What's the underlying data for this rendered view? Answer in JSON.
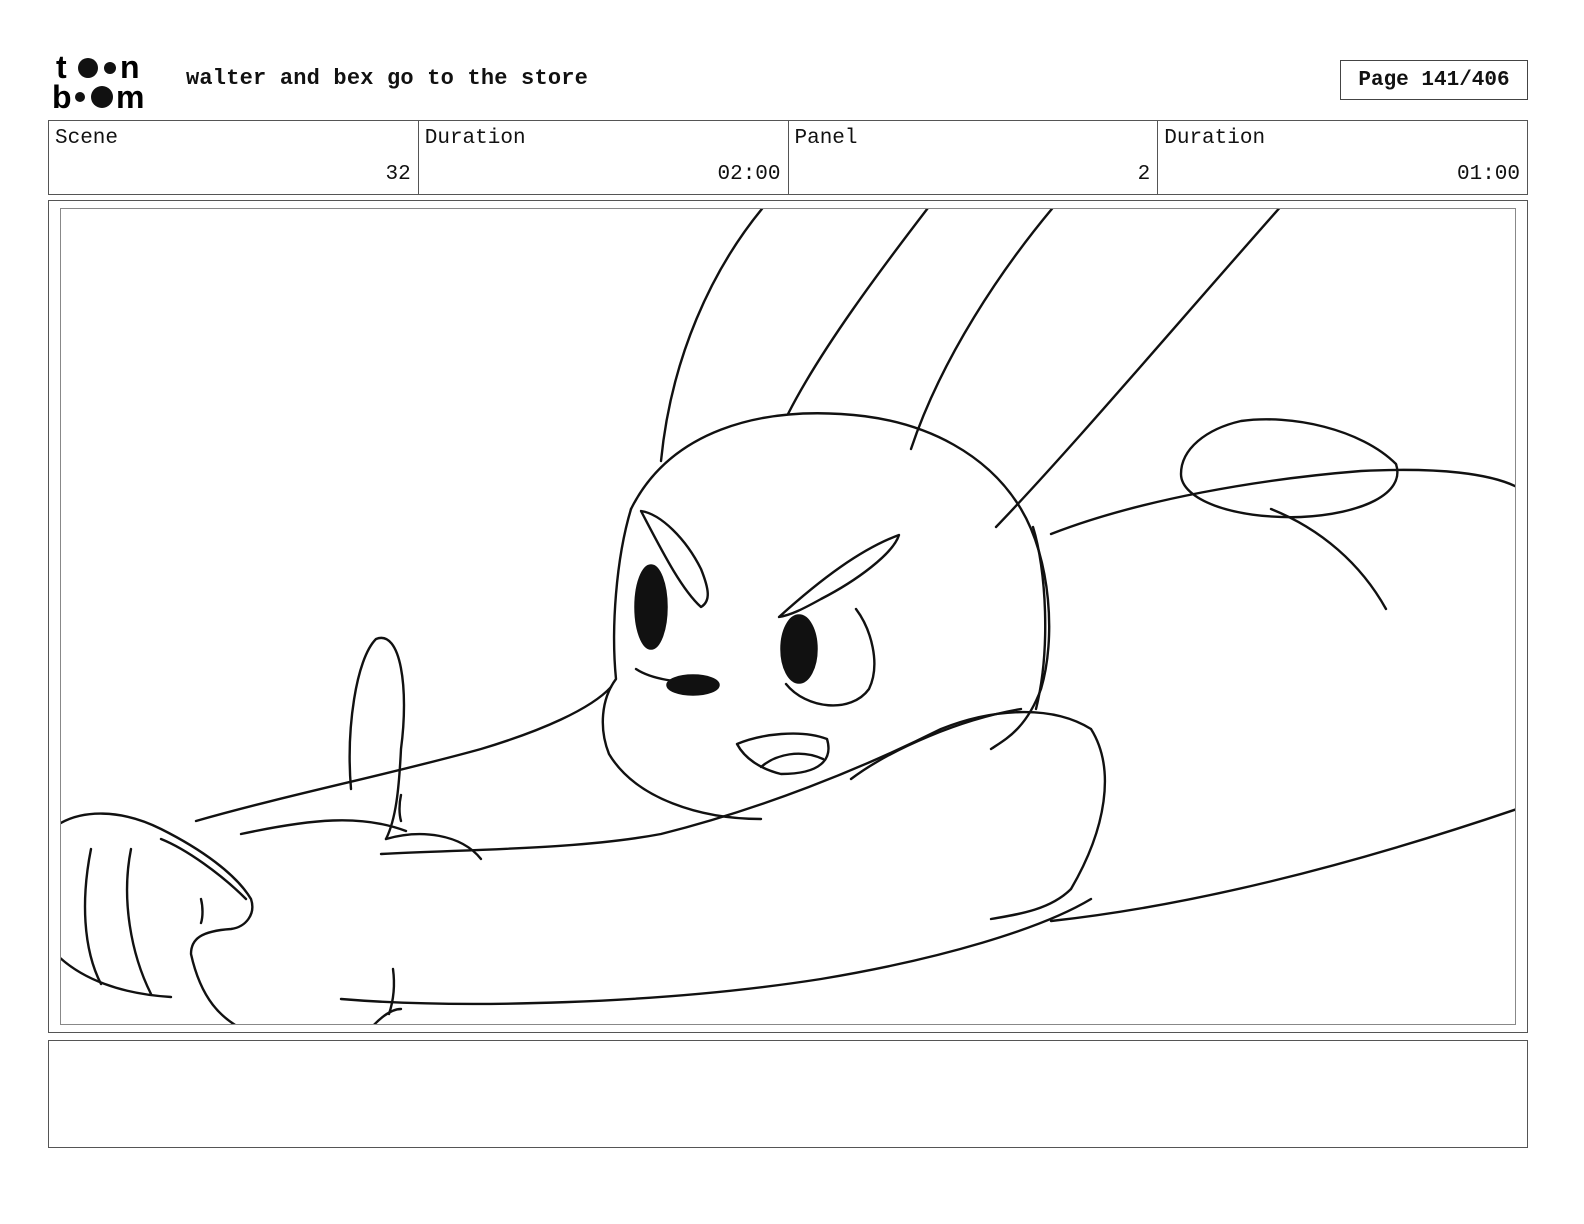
{
  "header": {
    "logo_text": "toon boom",
    "title": "walter and bex go to the store",
    "page_label": "Page 141/406"
  },
  "info": [
    {
      "label": "Scene",
      "value": "32"
    },
    {
      "label": "Duration",
      "value": "02:00"
    },
    {
      "label": "Panel",
      "value": "2"
    },
    {
      "label": "Duration",
      "value": "01:00"
    }
  ],
  "notes": {
    "text": ""
  }
}
